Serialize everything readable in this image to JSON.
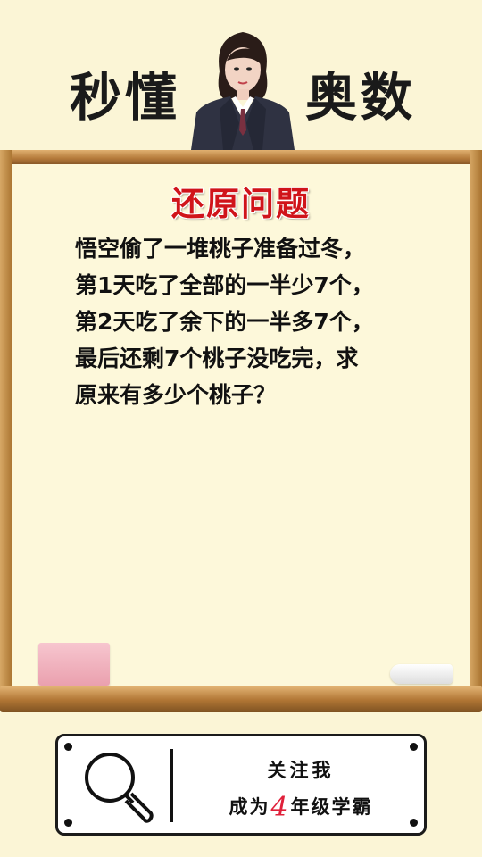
{
  "header": {
    "brand_left": "秒懂",
    "brand_right": "奥数"
  },
  "problem": {
    "title": "还原问题",
    "lines": [
      "悟空偷了一堆桃子准备过冬，",
      "第1天吃了全部的一半少7个，",
      "第2天吃了余下的一半多7个，",
      "最后还剩7个桃子没吃完，求",
      "原来有多少个桃子？"
    ]
  },
  "footer": {
    "follow_text": "关注我",
    "become_prefix": "成为",
    "grade_number": "4",
    "grade_suffix": "年级学霸"
  },
  "colors": {
    "background": "#fbf5d6",
    "title_red": "#d0141a",
    "grade_red": "#e0203a",
    "wood": "#b47a3a"
  }
}
